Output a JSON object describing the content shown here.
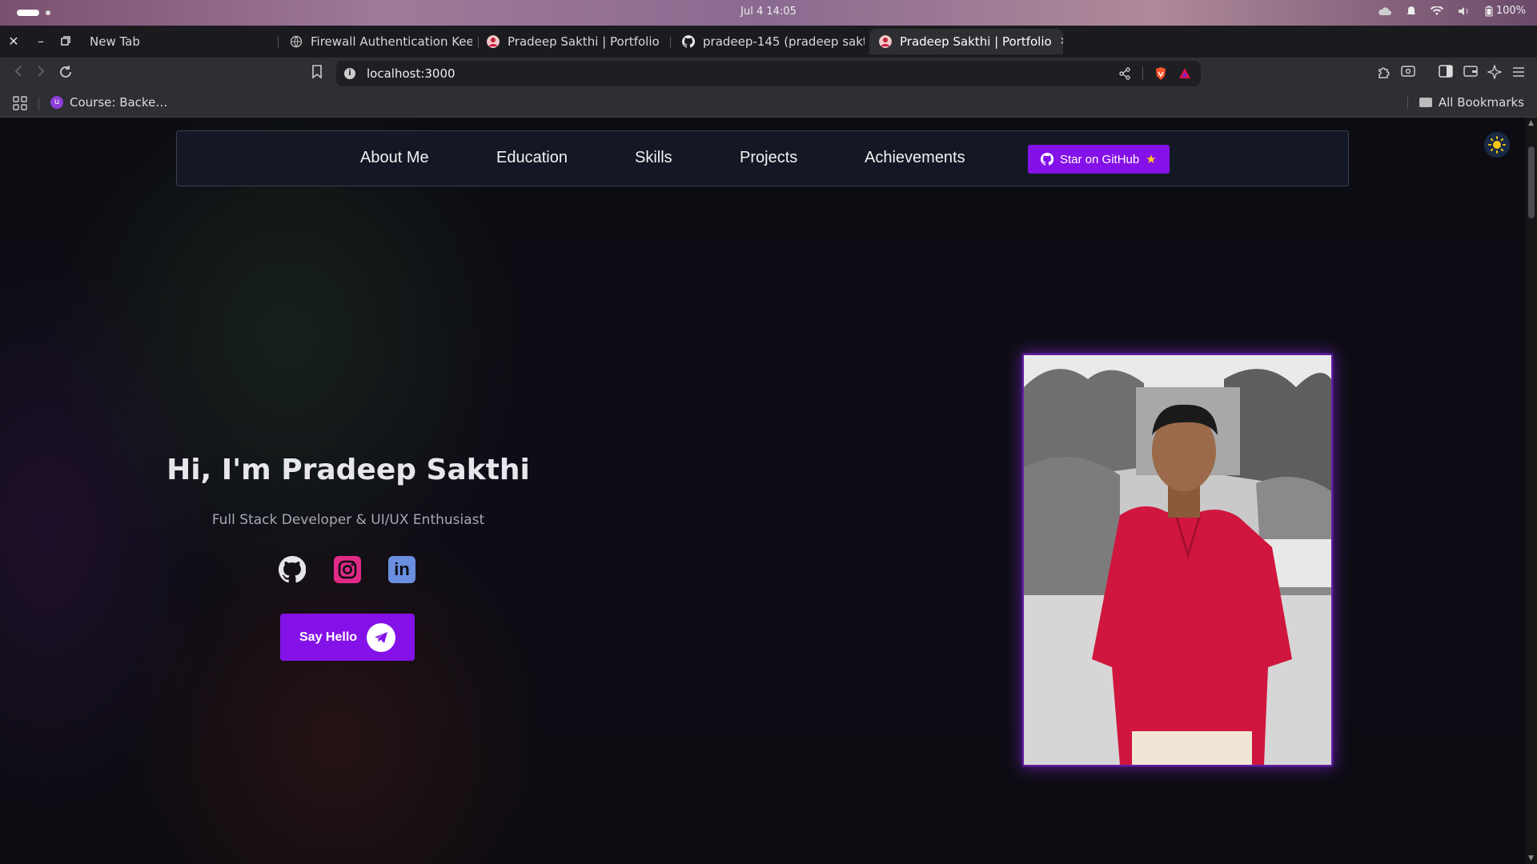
{
  "os": {
    "clock": "Jul 4  14:05",
    "battery": "100%"
  },
  "browser": {
    "tabs": [
      {
        "title": "New Tab",
        "favicon": "none"
      },
      {
        "title": "Firewall Authentication Keep",
        "favicon": "globe-icon"
      },
      {
        "title": "Pradeep Sakthi | Portfolio",
        "favicon": "portfolio-favicon"
      },
      {
        "title": "pradeep-145 (pradeep sakthi",
        "favicon": "github-icon"
      },
      {
        "title": "Pradeep Sakthi | Portfolio",
        "favicon": "portfolio-favicon",
        "active": true
      }
    ],
    "url": "localhost:3000",
    "bookmarks": [
      {
        "label": "Course: Backe…",
        "icon": "course-favicon"
      }
    ],
    "all_bookmarks_label": "All Bookmarks"
  },
  "site": {
    "nav": [
      "About Me",
      "Education",
      "Skills",
      "Projects",
      "Achievements"
    ],
    "star_button": "Star on GitHub",
    "hero": {
      "title": "Hi, I'm Pradeep Sakthi",
      "subtitle": "Full Stack Developer & UI/UX Enthusiast",
      "cta": "Say Hello",
      "socials": [
        "github-icon",
        "instagram-icon",
        "linkedin-icon"
      ],
      "linkedin_glyph": "in"
    }
  },
  "colors": {
    "accent": "#8412e8",
    "instagram": "#e02a86",
    "linkedin": "#6a8fe0",
    "star": "#ffd21a",
    "shirt": "#d0163e"
  }
}
